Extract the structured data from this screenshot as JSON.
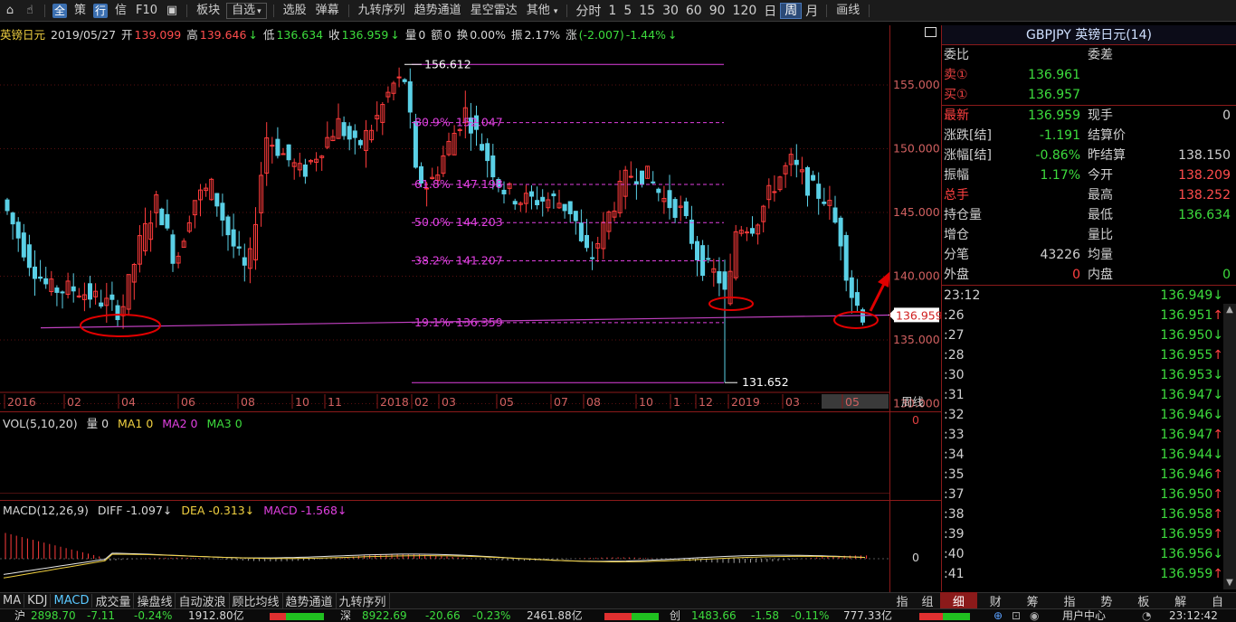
{
  "toolbar": {
    "left_icons": [
      "home-icon",
      "pointer-icon"
    ],
    "quick_all": "全",
    "items_a": [
      "策"
    ],
    "quick_row": "行",
    "items_b": [
      "信",
      "F10"
    ],
    "sector": "板块",
    "watchlist": "自选",
    "menu": [
      "选股",
      "弹幕",
      "九转序列",
      "趋势通道",
      "星空雷达",
      "其他"
    ],
    "periods": [
      "分时",
      "1",
      "5",
      "15",
      "30",
      "60",
      "90",
      "120",
      "日",
      "周",
      "月"
    ],
    "active_period": "周",
    "draw": "画线"
  },
  "info": {
    "name": "英镑日元",
    "date": "2019/05/27",
    "open_label": "开",
    "open": "139.099",
    "high_label": "高",
    "high": "139.646",
    "low_label": "低",
    "low": "136.634",
    "close_label": "收",
    "close": "136.959",
    "vol_label": "量",
    "vol": "0",
    "amount_label": "额",
    "amount": "0",
    "turnover_label": "换",
    "turnover": "0.00%",
    "amp_label": "振",
    "amp": "2.17%",
    "chg_label": "涨",
    "chg": "(-2.007)",
    "chg_pct": "-1.44%"
  },
  "chart_data": {
    "type": "candlestick",
    "y_ticks": [
      "155.000",
      "150.000",
      "145.000",
      "140.000",
      "135.000",
      "130.000"
    ],
    "x_ticks": [
      "2016",
      "02",
      "04",
      "06",
      "08",
      "10",
      "11",
      "2018",
      "02",
      "03",
      "05",
      "07",
      "08",
      "10",
      "1",
      "12",
      "2019",
      "03",
      "05"
    ],
    "x_label_right": "周线",
    "high_marker": "156.612",
    "low_marker": "131.652",
    "current_price_tag": "136.959",
    "fib_levels": [
      {
        "label": "80.9%",
        "value": "152.047"
      },
      {
        "label": "61.8%",
        "value": "147.198"
      },
      {
        "label": "50.0%",
        "value": "144.203"
      },
      {
        "label": "38.2%",
        "value": "141.207"
      },
      {
        "label": "19.1%",
        "value": "136.359"
      }
    ],
    "support_line": 136.1,
    "colors": {
      "up": "#ff3b3b",
      "down": "#5ad0e6",
      "fib": "#e040e0",
      "support": "#c040c0",
      "annot": "#e00000"
    }
  },
  "volume": {
    "title": "VOL(5,10,20)",
    "items": [
      {
        "label": "量",
        "value": "0"
      },
      {
        "label": "MA1",
        "value": "0"
      },
      {
        "label": "MA2",
        "value": "0"
      },
      {
        "label": "MA3",
        "value": "0"
      }
    ],
    "axis_zero": "0"
  },
  "macd": {
    "title": "MACD(12,26,9)",
    "diff_label": "DIFF",
    "diff": "-1.097",
    "dea_label": "DEA",
    "dea": "-0.313",
    "macd_label": "MACD",
    "macd": "-1.568",
    "axis_zero": "0"
  },
  "panel": {
    "title": "GBPJPY 英镑日元(14)",
    "rows_top": [
      {
        "l1": "委比",
        "v1": "",
        "l2": "委差",
        "v2": ""
      },
      {
        "l1": "卖①",
        "v1": "136.961",
        "l2": "",
        "v2": ""
      },
      {
        "l1": "买①",
        "v1": "136.957",
        "l2": "",
        "v2": ""
      }
    ],
    "rows_mid": [
      {
        "l1": "最新",
        "v1": "136.959",
        "l2": "现手",
        "v2": "0"
      },
      {
        "l1": "涨跌[结]",
        "v1": "-1.191",
        "l2": "结算价",
        "v2": ""
      },
      {
        "l1": "涨幅[结]",
        "v1": "-0.86%",
        "l2": "昨结算",
        "v2": "138.150"
      },
      {
        "l1": "振幅",
        "v1": "1.17%",
        "l2": "今开",
        "v2": "138.209"
      },
      {
        "l1": "总手",
        "v1": "",
        "l2": "最高",
        "v2": "138.252"
      },
      {
        "l1": "持仓量",
        "v1": "",
        "l2": "最低",
        "v2": "136.634"
      },
      {
        "l1": "增仓",
        "v1": "",
        "l2": "量比",
        "v2": ""
      },
      {
        "l1": "分笔",
        "v1": "43226",
        "l2": "均量",
        "v2": ""
      },
      {
        "l1": "外盘",
        "v1": "0",
        "l2": "内盘",
        "v2": "0"
      }
    ],
    "ticks": [
      {
        "t": "23:12",
        "p": "136.949",
        "d": "↓"
      },
      {
        "t": ":26",
        "p": "136.951",
        "d": "↑"
      },
      {
        "t": ":27",
        "p": "136.950",
        "d": "↓"
      },
      {
        "t": ":28",
        "p": "136.955",
        "d": "↑"
      },
      {
        "t": ":30",
        "p": "136.953",
        "d": "↓"
      },
      {
        "t": ":31",
        "p": "136.947",
        "d": "↓"
      },
      {
        "t": ":32",
        "p": "136.946",
        "d": "↓"
      },
      {
        "t": ":33",
        "p": "136.947",
        "d": "↑"
      },
      {
        "t": ":34",
        "p": "136.944",
        "d": "↓"
      },
      {
        "t": ":35",
        "p": "136.946",
        "d": "↑"
      },
      {
        "t": ":37",
        "p": "136.950",
        "d": "↑"
      },
      {
        "t": ":38",
        "p": "136.958",
        "d": "↑"
      },
      {
        "t": ":39",
        "p": "136.959",
        "d": "↑"
      },
      {
        "t": ":40",
        "p": "136.956",
        "d": "↓"
      },
      {
        "t": ":41",
        "p": "136.959",
        "d": "↑"
      }
    ]
  },
  "bottom_tabs": [
    "MA",
    "KDJ",
    "MACD",
    "成交量",
    "操盘线",
    "自动波浪",
    "顾比均线",
    "趋势通道",
    "九转序列"
  ],
  "bottom_tabs_active": "MACD",
  "bottom_right_labels": [
    "指",
    "组"
  ],
  "right_tabs": [
    "细",
    "财",
    "筹",
    "指",
    "势",
    "板",
    "解",
    "自"
  ],
  "right_tabs_active": "细",
  "status": {
    "sh_label": "沪",
    "sh": "2898.70",
    "sh_chg": "-7.11",
    "sh_pct": "-0.24%",
    "sh_amt": "1912.80亿",
    "sz_label": "深",
    "sz": "8922.69",
    "sz_chg": "-20.66",
    "sz_pct": "-0.23%",
    "sz_amt": "2461.88亿",
    "cy_label": "创",
    "cy": "1483.66",
    "cy_chg": "-1.58",
    "cy_pct": "-0.11%",
    "cy_amt": "777.33亿",
    "center": "用户中心",
    "time": "23:12:42"
  }
}
